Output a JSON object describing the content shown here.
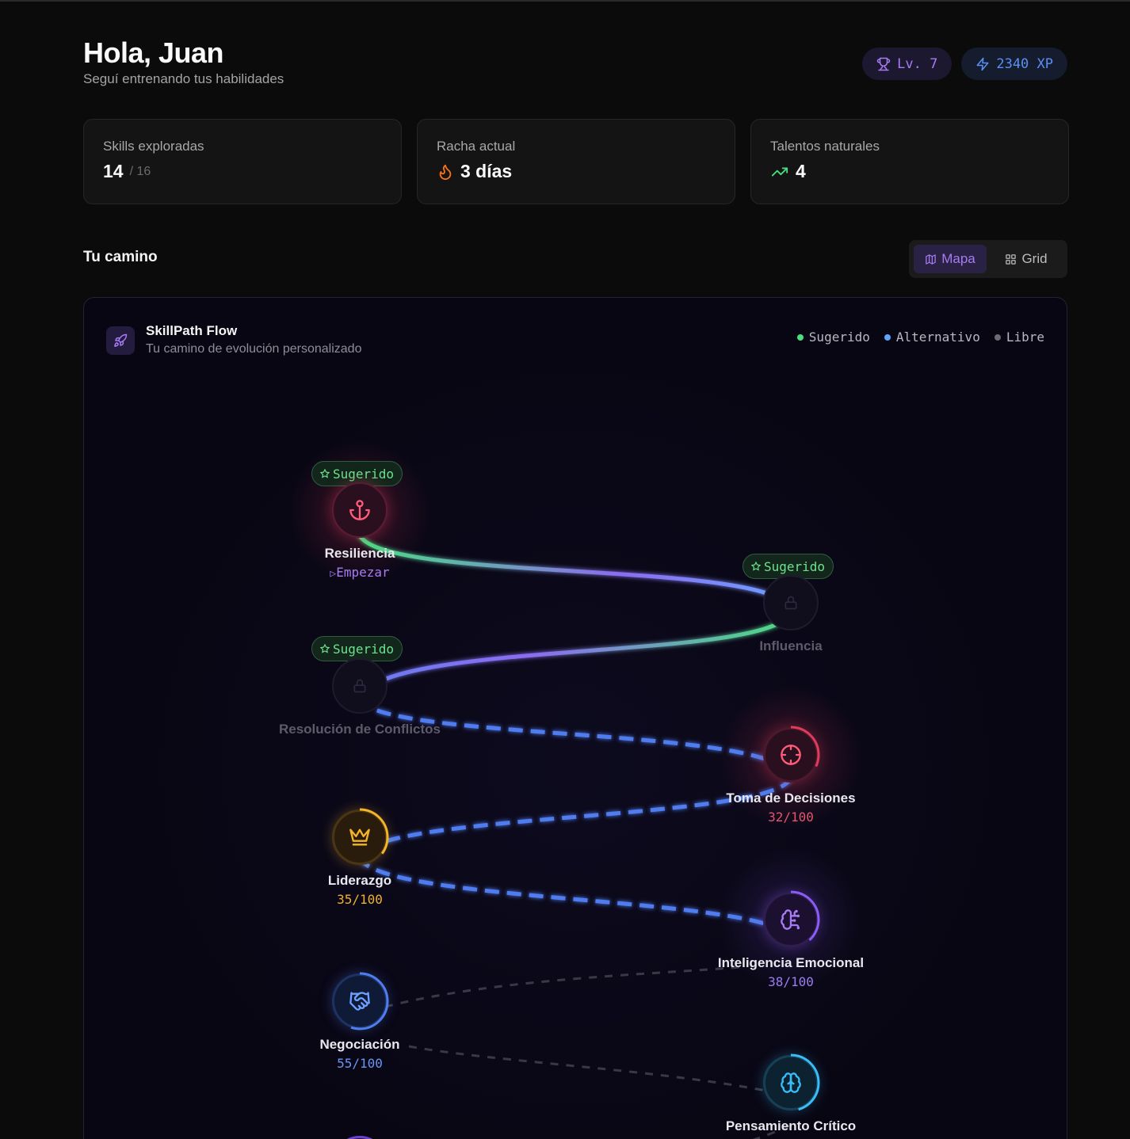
{
  "header": {
    "greeting": "Hola, Juan",
    "subtitle": "Seguí entrenando tus habilidades"
  },
  "badges": {
    "level": "Lv. 7",
    "xp": "2340 XP"
  },
  "stats": [
    {
      "label": "Skills exploradas",
      "value": "14",
      "suffix": "/ 16"
    },
    {
      "label": "Racha actual",
      "value": "3 días"
    },
    {
      "label": "Talentos naturales",
      "value": "4"
    }
  ],
  "section": {
    "title": "Tu camino"
  },
  "view_toggle": {
    "map": "Mapa",
    "grid": "Grid"
  },
  "flow": {
    "title": "SkillPath Flow",
    "subtitle": "Tu camino de evolución personalizado",
    "legend": {
      "suggested": "Sugerido",
      "alternative": "Alternativo",
      "free": "Libre"
    },
    "tag_label": "Sugerido",
    "nodes": {
      "resiliencia": {
        "name": "Resiliencia",
        "action": "Empezar"
      },
      "influencia": {
        "name": "Influencia"
      },
      "conflictos": {
        "name": "Resolución de Conflictos"
      },
      "decisiones": {
        "name": "Toma de Decisiones",
        "progress": "32/100"
      },
      "liderazgo": {
        "name": "Liderazgo",
        "progress": "35/100"
      },
      "emocional": {
        "name": "Inteligencia Emocional",
        "progress": "38/100"
      },
      "negociacion": {
        "name": "Negociación",
        "progress": "55/100"
      },
      "critico": {
        "name": "Pensamiento Crítico"
      }
    }
  },
  "colors": {
    "suggested": "#4ade80",
    "alternative": "#60a5fa",
    "free": "#6b6b74",
    "accent": "#a77bf3"
  }
}
